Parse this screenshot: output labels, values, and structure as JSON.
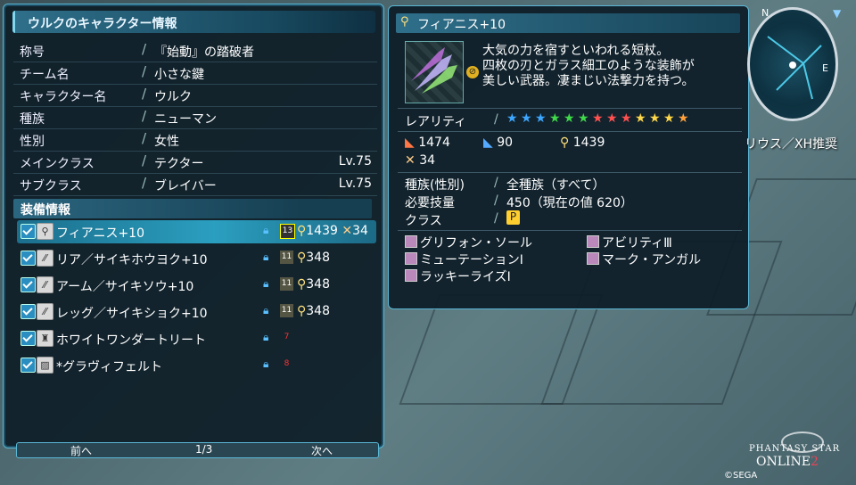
{
  "character_window": {
    "title": "ウルクのキャラクター情報",
    "rows": [
      {
        "label": "称号",
        "value": "『始動』の踏破者",
        "level": ""
      },
      {
        "label": "チーム名",
        "value": "小さな鍵",
        "level": ""
      },
      {
        "label": "キャラクター名",
        "value": "ウルク",
        "level": ""
      },
      {
        "label": "種族",
        "value": "ニューマン",
        "level": ""
      },
      {
        "label": "性別",
        "value": "女性",
        "level": ""
      },
      {
        "label": "メインクラス",
        "value": "テクター",
        "level": "Lv.75"
      },
      {
        "label": "サブクラス",
        "value": "ブレイバー",
        "level": "Lv.75"
      }
    ],
    "equip_header": "装備情報",
    "equipment": [
      {
        "name": "フィアニス+10",
        "icon": "wand-icon",
        "elem": "13",
        "atk": "1439",
        "extra": "34"
      },
      {
        "name": "リア／サイキホウヨク+10",
        "icon": "rear-unit-icon",
        "elem": "11",
        "atk": "348",
        "extra": ""
      },
      {
        "name": "アーム／サイキソウ+10",
        "icon": "arm-unit-icon",
        "elem": "11",
        "atk": "348",
        "extra": ""
      },
      {
        "name": "レッグ／サイキショク+10",
        "icon": "leg-unit-icon",
        "elem": "11",
        "atk": "348",
        "extra": ""
      },
      {
        "name": "ホワイトワンダートリート",
        "icon": "costume-icon",
        "elem": "7",
        "atk": "",
        "extra": ""
      },
      {
        "name": "*グラヴィフェルト",
        "icon": "inner-wear-icon",
        "elem": "8",
        "atk": "",
        "extra": ""
      }
    ],
    "pager": {
      "prev": "前へ",
      "page": "1/3",
      "next": "次へ"
    }
  },
  "item_window": {
    "title": "フィアニス+10",
    "description": [
      "大気の力を宿すといわれる短杖。",
      "四枚の刃とガラス細工のような装飾が",
      "美しい武器。凄まじい法撃力を持つ。"
    ],
    "rarity_label": "レアリティ",
    "stars": [
      "#3da7ff",
      "#3da7ff",
      "#3da7ff",
      "#3fd94a",
      "#3fd94a",
      "#3fd94a",
      "#ff5050",
      "#ff5050",
      "#ff5050",
      "#ffd84a",
      "#ffd84a",
      "#ffd84a",
      "#ff9f3a"
    ],
    "stats": {
      "strike": "1474",
      "range": "90",
      "tech": "1439",
      "element": "34"
    },
    "race_label": "種族(性別)",
    "race_value": "全種族（すべて）",
    "req_label": "必要技量",
    "req_value": "450（現在の値 620）",
    "class_label": "クラス",
    "class_value": "P",
    "affixes": [
      "グリフォン・ソール",
      "アビリティⅢ",
      "ミューテーションⅠ",
      "マーク・アンガル",
      "ラッキーライズⅠ"
    ]
  },
  "hud": {
    "quest": "リウス／XH推奨",
    "logo_line1": "PHANTASY STAR",
    "logo_line2": "ONLINE",
    "logo_num": "2",
    "copyright": "©SEGA"
  }
}
